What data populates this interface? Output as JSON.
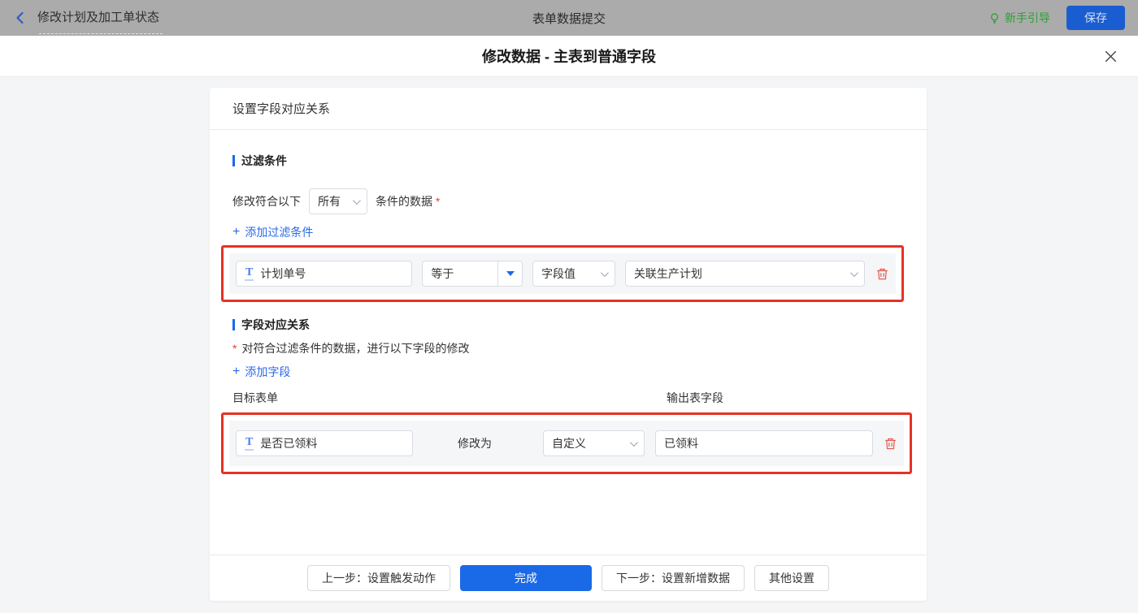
{
  "topbar": {
    "back_title": "修改计划及加工单状态",
    "center_title": "表单数据提交",
    "guide_label": "新手引导",
    "save_label": "保存"
  },
  "dialog": {
    "title": "修改数据 - 主表到普通字段",
    "panel_title": "设置字段对应关系",
    "filter": {
      "section_title": "过滤条件",
      "match_prefix": "修改符合以下",
      "match_mode": "所有",
      "match_suffix": "条件的数据",
      "required_mark": "*",
      "add_icon": "+",
      "add_label": "添加过滤条件",
      "condition": {
        "field_icon": "T",
        "field": "计划单号",
        "operator": "等于",
        "value_type": "字段值",
        "value": "关联生产计划"
      }
    },
    "mapping": {
      "section_title": "字段对应关系",
      "required_mark": "*",
      "description": "对符合过滤条件的数据，进行以下字段的修改",
      "add_icon": "+",
      "add_label": "添加字段",
      "columns": {
        "target": "目标表单",
        "output": "输出表字段"
      },
      "row": {
        "field_icon": "T",
        "field": "是否已领料",
        "action_label": "修改为",
        "mode": "自定义",
        "value": "已领料"
      }
    },
    "footer": {
      "prev": "上一步：设置触发动作",
      "done": "完成",
      "next": "下一步：设置新增数据",
      "other": "其他设置"
    }
  },
  "colors": {
    "primary_blue": "#1a6ae8",
    "link_blue": "#2a6ae9",
    "guide_green": "#2f9e35",
    "highlight_red": "#e63223",
    "danger_red": "#e85c54",
    "topbar_dimmed_bg": "#ababab"
  }
}
